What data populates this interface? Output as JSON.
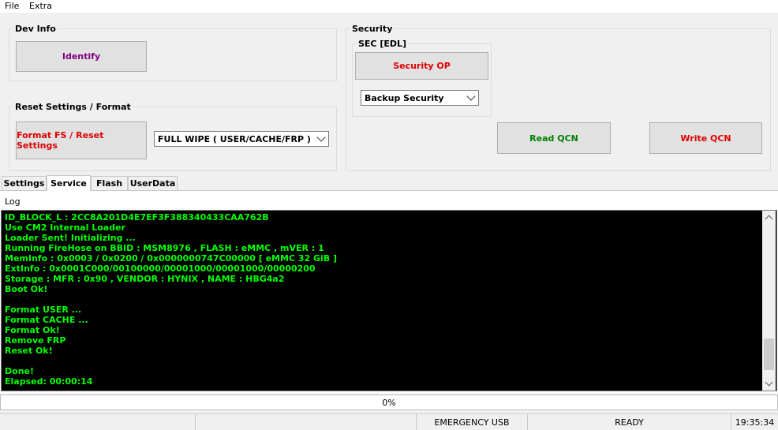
{
  "menu": {
    "items": [
      "File",
      "Extra"
    ]
  },
  "dev_info": {
    "title": "Dev Info",
    "identify_label": "Identify"
  },
  "reset": {
    "title": "Reset Settings / Format",
    "format_label": "Format FS / Reset Settings",
    "wipe_selected": "FULL WIPE ( USER/CACHE/FRP )"
  },
  "security": {
    "title": "Security",
    "sec_edl_title": "SEC [EDL]",
    "security_op_label": "Security OP",
    "backup_selected": "Backup Security",
    "read_qcn_label": "Read QCN",
    "write_qcn_label": "Write QCN"
  },
  "tabs": [
    {
      "label": "Settings",
      "active": false
    },
    {
      "label": "Service",
      "active": true
    },
    {
      "label": "Flash",
      "active": false
    },
    {
      "label": "UserData",
      "active": false
    }
  ],
  "log": {
    "label": "Log",
    "lines": [
      "ID_BLOCK_L : 2CC8A201D4E7EF3F388340433CAA762B",
      "Use CM2 Internal Loader",
      "Loader Sent! Initializing ...",
      "Running FireHose on BBID : MSM8976 , FLASH : eMMC , mVER : 1",
      "MemInfo : 0x0003 / 0x0200 / 0x0000000747C00000 [ eMMC 32 GiB ]",
      "ExtInfo : 0x0001C000/00100000/00001000/00001000/00000200",
      "Storage : MFR : 0x90 , VENDOR : HYNIX , NAME : HBG4a2",
      "Boot Ok!",
      "",
      "Format USER ...",
      "Format CACHE ...",
      "Format Ok!",
      "Remove FRP",
      "Reset Ok!",
      "",
      "Done!",
      "Elapsed: 00:00:14"
    ]
  },
  "progress": {
    "value": 0,
    "text": "0%"
  },
  "status": {
    "mode": "EMERGENCY USB",
    "state": "READY",
    "time": "19:35:34"
  },
  "colors": {
    "identify": "#800080",
    "red_action": "#e00000",
    "green_action": "#008000",
    "log_text": "#00ff00",
    "log_bg": "#000000"
  }
}
